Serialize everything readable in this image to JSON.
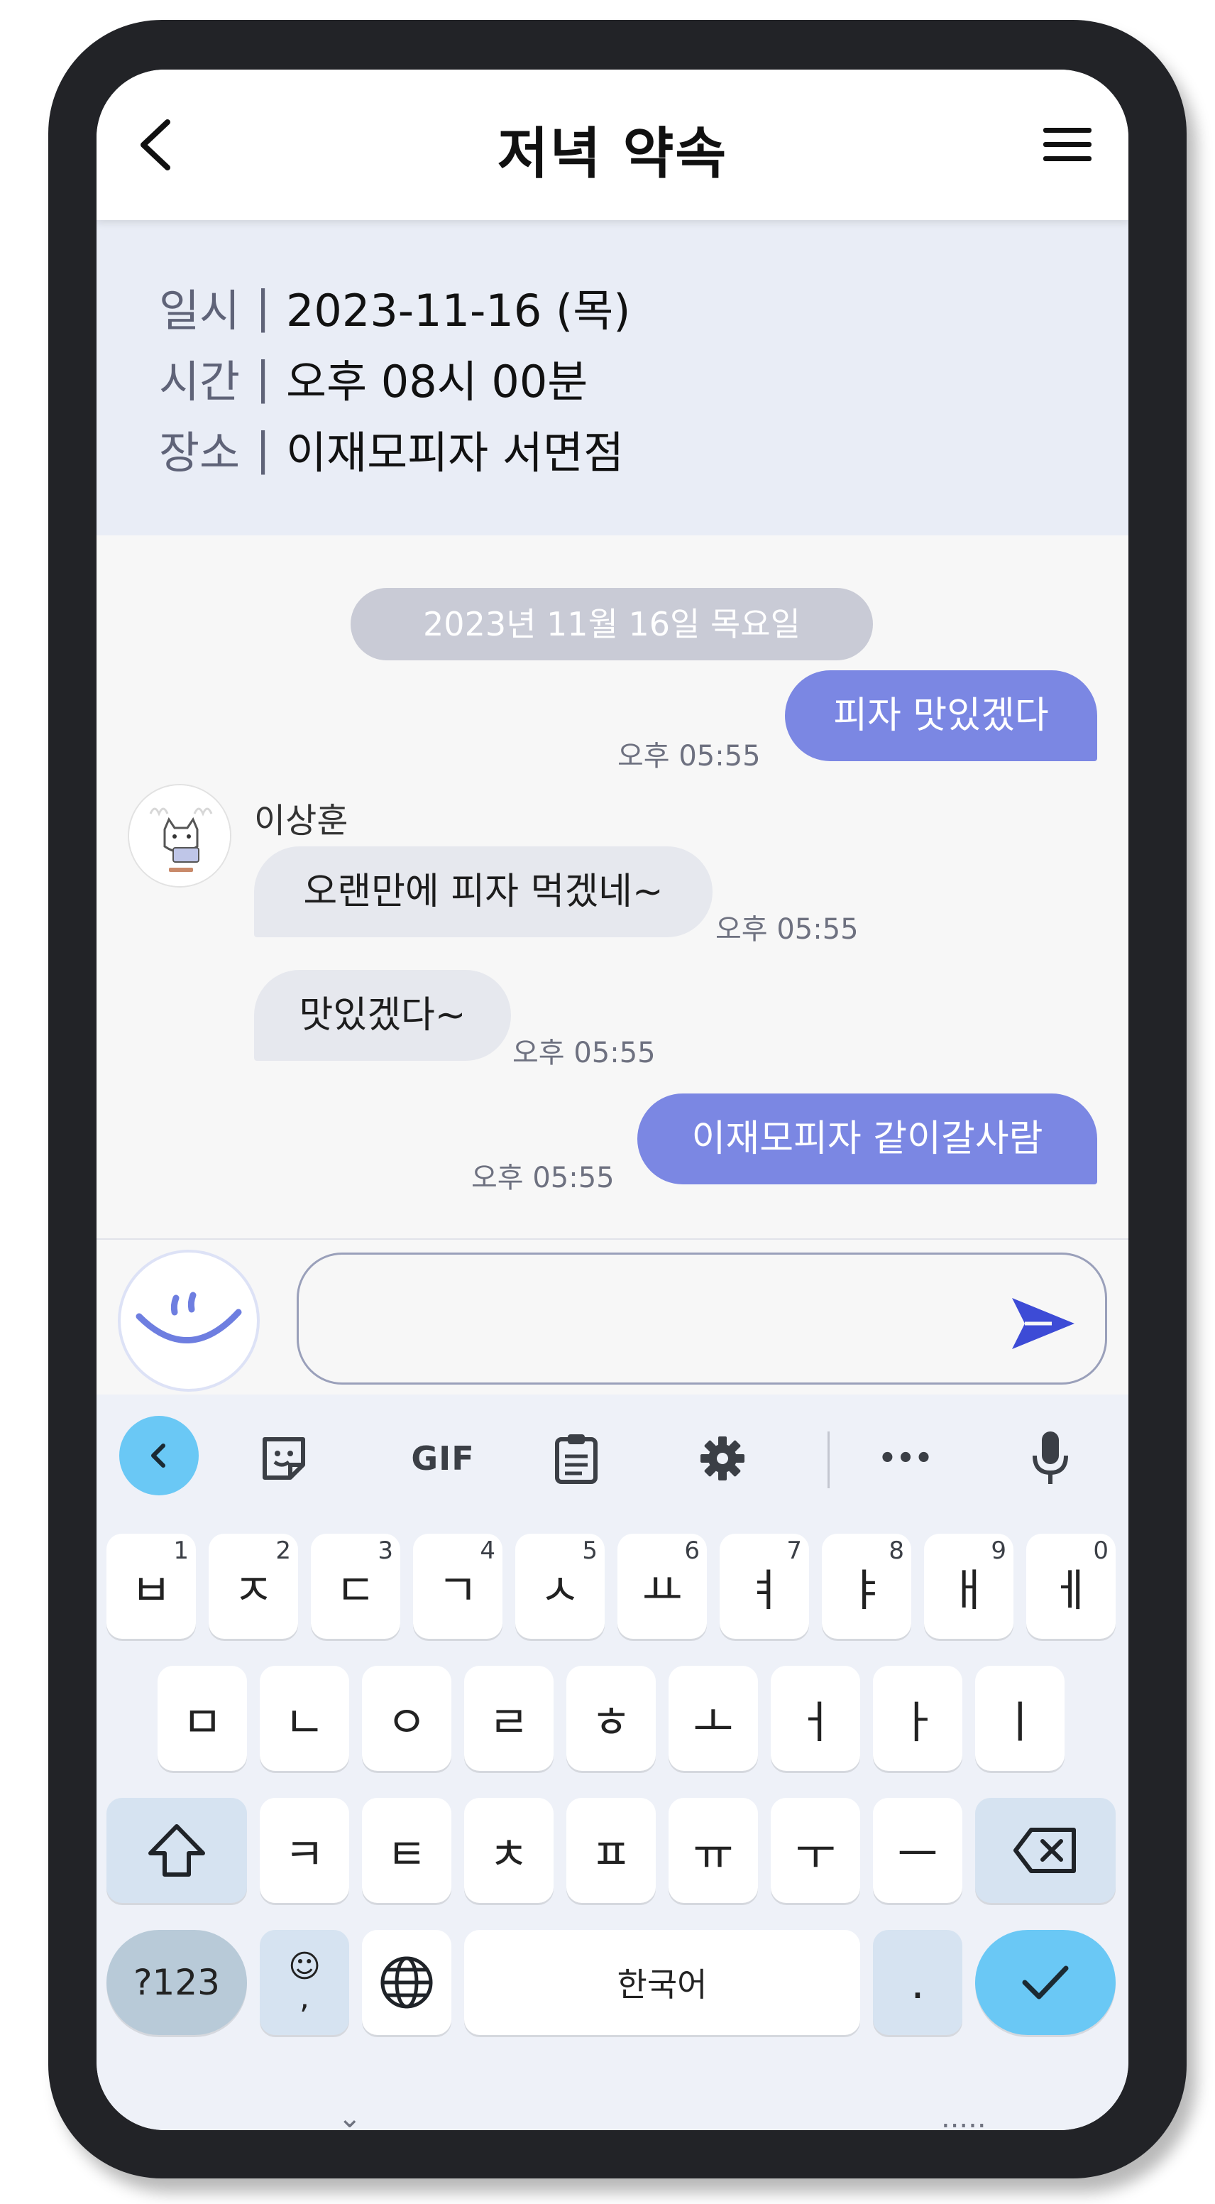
{
  "header": {
    "title": "저녁 약속"
  },
  "info": [
    {
      "label": "일시",
      "separator": "|",
      "value": "2023-11-16 (목)"
    },
    {
      "label": "시간",
      "separator": "|",
      "value": "오후 08시 00분"
    },
    {
      "label": "장소",
      "separator": "|",
      "value": "이재모피자 서면점"
    }
  ],
  "chat": {
    "date_chip": "2023년 11월 16일 목요일",
    "sender": "이상훈",
    "messages": [
      {
        "side": "mine",
        "text": "피자 맛있겠다",
        "time": "오후 05:55"
      },
      {
        "side": "theirs",
        "text": "오랜만에 피자 먹겠네~",
        "time": "오후 05:55"
      },
      {
        "side": "theirs",
        "text": "맛있겠다~",
        "time": "오후 05:55"
      },
      {
        "side": "mine",
        "text": "이재모피자 같이갈사람",
        "time": "오후 05:55"
      }
    ]
  },
  "composer": {
    "value": "",
    "placeholder": ""
  },
  "keyboard": {
    "toolbar": {
      "gif_label": "GIF",
      "more_label": "•••"
    },
    "row1": [
      {
        "key": "ㅂ",
        "hint": "1"
      },
      {
        "key": "ㅈ",
        "hint": "2"
      },
      {
        "key": "ㄷ",
        "hint": "3"
      },
      {
        "key": "ㄱ",
        "hint": "4"
      },
      {
        "key": "ㅅ",
        "hint": "5"
      },
      {
        "key": "ㅛ",
        "hint": "6"
      },
      {
        "key": "ㅕ",
        "hint": "7"
      },
      {
        "key": "ㅑ",
        "hint": "8"
      },
      {
        "key": "ㅐ",
        "hint": "9"
      },
      {
        "key": "ㅔ",
        "hint": "0"
      }
    ],
    "row2": [
      "ㅁ",
      "ㄴ",
      "ㅇ",
      "ㄹ",
      "ㅎ",
      "ㅗ",
      "ㅓ",
      "ㅏ",
      "ㅣ"
    ],
    "row3": [
      "ㅋ",
      "ㅌ",
      "ㅊ",
      "ㅍ",
      "ㅠ",
      "ㅜ",
      "ㅡ"
    ],
    "symbols_label": "?123",
    "emoji_comma": {
      "top": "☺",
      "bottom": ","
    },
    "space_label": "한국어",
    "period_label": ".",
    "nav_left": "⌄",
    "nav_right": "....."
  },
  "icons": {
    "back": "chevron-left-icon",
    "menu": "hamburger-icon",
    "send": "send-icon",
    "emoji": "smile-icon",
    "shift": "shift-icon",
    "backspace": "backspace-icon",
    "globe": "globe-icon",
    "check": "check-icon",
    "mic": "microphone-icon",
    "settings": "gear-icon",
    "clipboard": "clipboard-icon",
    "sticker": "sticker-icon"
  },
  "colors": {
    "my_bubble": "#7b87e3",
    "their_bubble": "#e6e8ee",
    "info_panel": "#e9edf6",
    "accent_keyboard": "#6ac8f5",
    "send": "#3d4bd6"
  }
}
